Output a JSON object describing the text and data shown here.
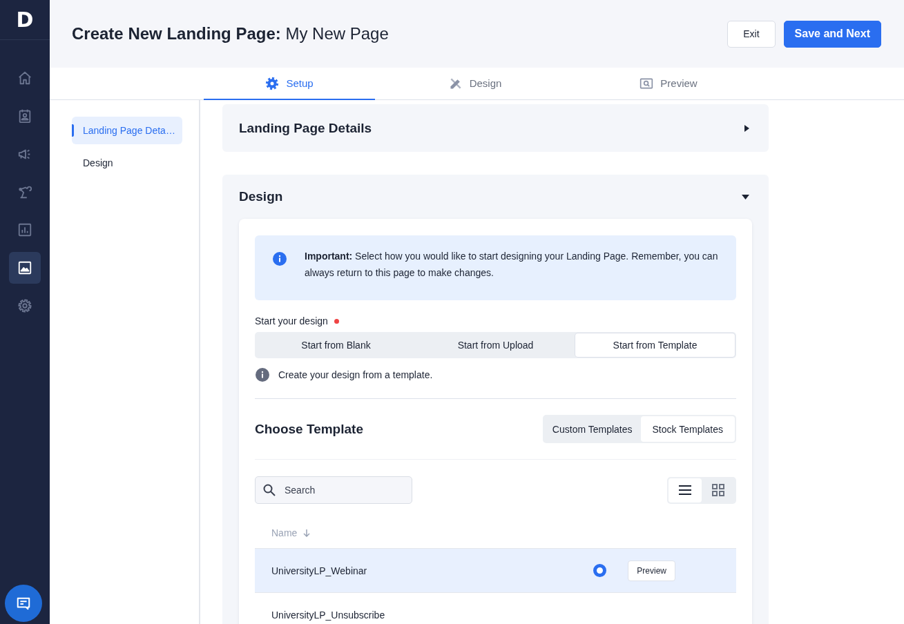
{
  "brand": {
    "logo": "D"
  },
  "nav": [
    {
      "kind": "home",
      "selected": false
    },
    {
      "kind": "contact",
      "selected": false
    },
    {
      "kind": "megaphone",
      "selected": false
    },
    {
      "kind": "robot",
      "selected": false
    },
    {
      "kind": "chart",
      "selected": false
    },
    {
      "kind": "image",
      "selected": true
    },
    {
      "kind": "gear",
      "selected": false
    }
  ],
  "header": {
    "title": "**Create New Landing Page:** My New Page",
    "buttons": [
      {
        "label": "Exit",
        "kind": "secondary"
      },
      {
        "label": "Save and Next",
        "kind": "primary"
      }
    ]
  },
  "tabs": [
    {
      "label": "Setup",
      "kind": "gear",
      "selected": true
    },
    {
      "label": "Design",
      "kind": "tools",
      "selected": false
    },
    {
      "label": "Preview",
      "kind": "preview",
      "selected": false
    }
  ],
  "steps": [
    {
      "label": "Landing Page Deta…",
      "selected": true
    },
    {
      "label": "Design",
      "selected": false
    }
  ],
  "panels": [
    {
      "title": "Landing Page Details",
      "expanded": false
    },
    {
      "title": "Design",
      "expanded": true
    }
  ],
  "design": {
    "notice": "**Important:** Select how you would like to start designing your Landing Page. Remember, you can always return to this page to make changes.",
    "start_label": "Start your design",
    "required": true,
    "start_options": [
      {
        "label": "Start from Blank",
        "selected": false
      },
      {
        "label": "Start from Upload",
        "selected": false
      },
      {
        "label": "Start from Template",
        "selected": true
      }
    ],
    "hint": "Create your design from a template.",
    "template_title": "Choose Template",
    "template_sources": [
      {
        "label": "Custom Templates",
        "selected": false
      },
      {
        "label": "Stock Templates",
        "selected": true
      }
    ],
    "search": {
      "placeholder": "Search"
    },
    "view_modes": [
      {
        "kind": "list",
        "selected": true
      },
      {
        "kind": "grid",
        "selected": false
      }
    ],
    "table": {
      "columns": [
        {
          "label": "Name",
          "sorted": true
        }
      ],
      "rows": [
        {
          "name": "UniversityLP_Webinar",
          "selected": true,
          "action": "Preview"
        },
        {
          "name": "UniversityLP_Unsubscribe",
          "selected": false
        }
      ]
    }
  }
}
